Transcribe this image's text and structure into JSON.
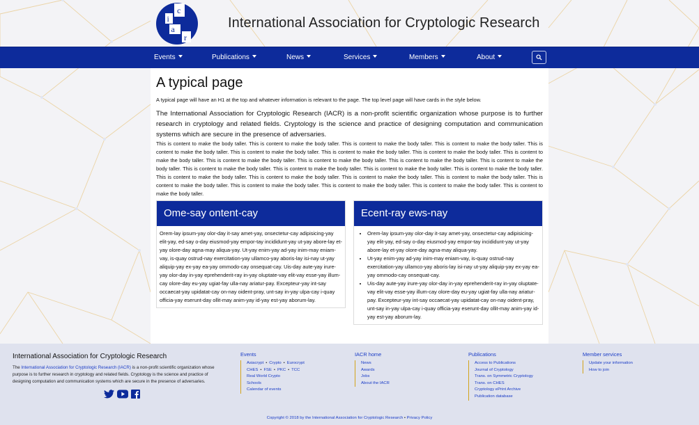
{
  "header": {
    "logo_letters": [
      "i",
      "a",
      "c",
      "r"
    ],
    "title": "International Association for Cryptologic Research"
  },
  "nav": {
    "items": [
      {
        "label": "Events"
      },
      {
        "label": "Publications"
      },
      {
        "label": "News"
      },
      {
        "label": "Services"
      },
      {
        "label": "Members"
      },
      {
        "label": "About"
      }
    ],
    "search_icon": "search-icon"
  },
  "main": {
    "title": "A typical page",
    "intro_small": "A typical page will have an H1 at the top and whatever information is relevant to the page. The top level page will have cards in the style below.",
    "intro_large": "The International Association for Cryptologic Research (IACR) is a non-profit scientific organization whose purpose is to further research in cryptology and related fields. Cryptology is the science and practice of designing computation and communication systems which are secure in the presence of adversaries.",
    "filler": "This is content to make the body taller. This is content to make the body taller. This is content to make the body taller. This is content to make the body taller. This is content to make the body taller. This is content to make the body taller. This is content to make the body taller. This is content to make the body taller. This is content to make the body taller. This is content to make the body taller. This is content to make the body taller. This is content to make the body taller. This is content to make the body taller. This is content to make the body taller. This is content to make the body taller. This is content to make the body taller. This is content to make the body taller. This is content to make the body taller. This is content to make the body taller. This is content to make the body taller. This is content to make the body taller. This is content to make the body taller. This is content to make the body taller. This is content to make the body taller. This is content to make the body taller. This is content to make the body taller."
  },
  "cards": [
    {
      "title": "Ome-say ontent-cay",
      "body": "Orem-lay ipsum-yay olor-day it-say amet-yay, onsectetur-cay adipisicing-yay elit-yay, ed-say o-day eiusmod-yay empor-tay incididunt-yay ut-yay abore-lay et-yay olore-day agna-may aliqua-yay. Ut-yay enim-yay ad-yay inim-may eniam-vay, is-quay ostrud-nay exercitation-yay ullamco-yay aboris-lay isi-nay ut-yay aliquip-yay ex-yay ea-yay ommodo-cay onsequat-cay. Uis-day aute-yay irure-yay olor-day in-yay eprehenderit-ray in-yay oluptate-vay elit-vay esse-yay illum-cay olore-day eu-yay ugiat-fay ulla-nay ariatur-pay. Excepteur-yay int-say occaecat-yay upidatat-cay on-nay oident-pray, unt-say in-yay ulpa-cay i-quay officia-yay eserunt-day ollit-may anim-yay id-yay est-yay aborum-lay."
    },
    {
      "title": "Ecent-ray ews-nay",
      "items": [
        "Orem-lay ipsum-yay olor-day it-say amet-yay, onsectetur-cay adipisicing-yay elit-yay, ed-say o-day eiusmod-yay empor-tay incididunt-yay ut-yay abore-lay et-yay olore-day agna-may aliqua-yay.",
        "Ut-yay enim-yay ad-yay inim-may eniam-vay, is-quay ostrud-nay exercitation-yay ullamco-yay aboris-lay isi-nay ut-yay aliquip-yay ex-yay ea-yay ommodo-cay onsequat-cay.",
        "Uis-day aute-yay irure-yay olor-day in-yay eprehenderit-ray in-yay oluptate-vay elit-vay esse-yay illum-cay olore-day eu-yay ugiat-fay ulla-nay ariatur-pay. Excepteur-yay int-say occaecat-yay upidatat-cay on-nay oident-pray, unt-say in-yay ulpa-cay i-quay officia-yay eserunt-day ollit-may anim-yay id-yay est-yay aborum-lay."
      ]
    }
  ],
  "footer": {
    "title": "International Association for Cryptologic Research",
    "desc_prefix": "The ",
    "desc_link": "International Association for Cryptologic Research (IACR)",
    "desc_suffix": " is a non-profit scientific organization whose purpose is to further research in cryptology and related fields. Cryptology is the science and practice of designing computation and communication systems which are secure in the presence of adversaries.",
    "social_icons": [
      "twitter-icon",
      "youtube-icon",
      "facebook-icon"
    ],
    "events": {
      "title": "Events",
      "rows": [
        [
          "Asiacrypt",
          "Crypto",
          "Eurocrypt"
        ],
        [
          "CHES",
          "FSE",
          "PKC",
          "TCC"
        ],
        [
          "Real World Crypto"
        ],
        [
          "Schools"
        ],
        [
          "Calendar of events"
        ]
      ]
    },
    "iacr_home": {
      "title": "IACR home",
      "links": [
        "News",
        "Awards",
        "Jobs",
        "About the IACR"
      ]
    },
    "publications": {
      "title": "Publications",
      "links": [
        "Access to Publications",
        "Journal of Cryptology",
        "Trans. on Symmetric Cryptology",
        "Trans. on CHES",
        "Cryptology ePrint Archive",
        "Publication database"
      ]
    },
    "member_services": {
      "title": "Member services",
      "links": [
        "Update your information",
        "How to join"
      ]
    },
    "copyright_link": "Copyright © 2018 by the International Association for Cryptologic Research",
    "copyright_sep": " • ",
    "privacy": "Privacy Policy"
  },
  "colors": {
    "navbar": "#0d2b9b",
    "link": "#1a3cc6",
    "accent_line": "#d3a31a"
  }
}
